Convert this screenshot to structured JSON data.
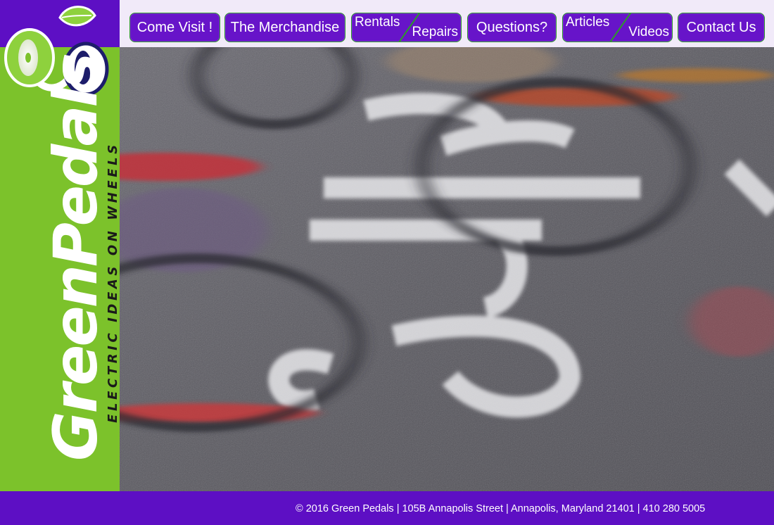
{
  "brand": {
    "name": "GreenPedals",
    "tagline": "ELECTRIC IDEAS ON WHEELS"
  },
  "nav": {
    "come_visit": "Come Visit !",
    "merchandise": "The Merchandise",
    "rentals": "Rentals",
    "repairs": "Repairs",
    "questions": "Questions?",
    "articles": "Articles",
    "videos": "Videos",
    "contact": "Contact Us"
  },
  "footer": {
    "text": "© 2016 Green Pedals | 105B Annapolis Street | Annapolis, Maryland 21401 | 410 280 5005"
  },
  "colors": {
    "purple": "#5d0fc4",
    "green": "#7cc22b",
    "button_border": "#2d9a2a"
  },
  "icons": {
    "logo": "bicycle-leaf-logo-icon"
  }
}
